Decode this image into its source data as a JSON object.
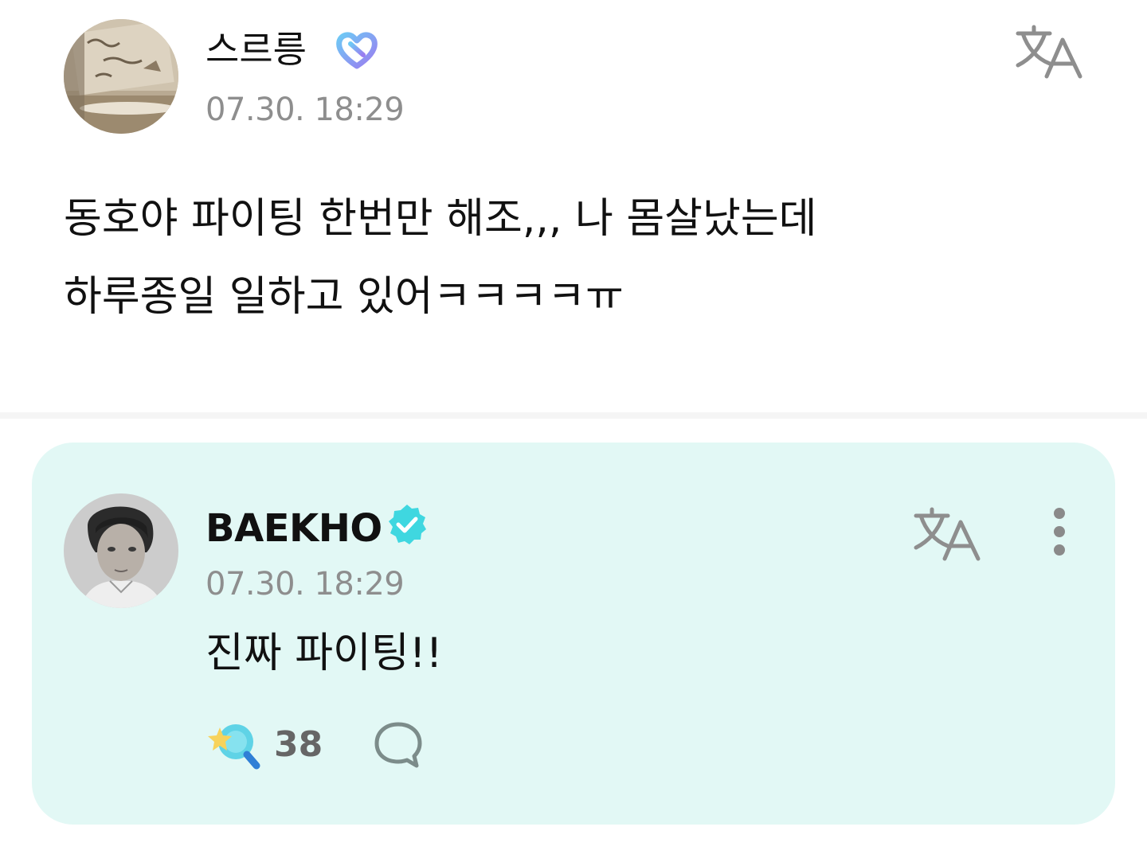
{
  "post": {
    "author": "스르릉",
    "badge_icon": "fan-membership-heart-icon",
    "timestamp": "07.30. 18:29",
    "translate_icon": "translate-icon",
    "body_lines": [
      "동호야 파이팅 한번만 해조,,, 나 몸살났는데",
      "하루종일 일하고 있어ㅋㅋㅋㅋㅠ"
    ]
  },
  "reply": {
    "author": "BAEKHO",
    "badge_icon": "verified-check-icon",
    "timestamp": "07.30. 18:29",
    "translate_icon": "translate-icon",
    "more_icon": "more-vertical-icon",
    "body": "진짜 파이팅!!",
    "reaction_icon": "star-wand-reaction-icon",
    "reaction_count": "38",
    "comment_icon": "comment-bubble-icon"
  },
  "colors": {
    "reply_card_bg": "#e2f8f5",
    "verified_badge": "#3fd7e0",
    "fan_badge_gradient": [
      "#6ec9f5",
      "#9b7cf0"
    ],
    "timestamp": "#8e8e8e"
  }
}
